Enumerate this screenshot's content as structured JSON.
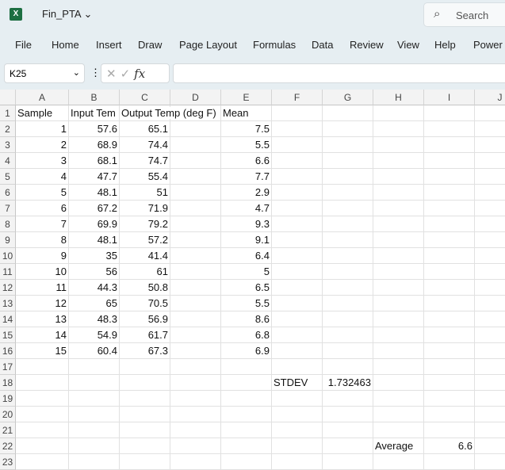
{
  "app": {
    "title": "Fin_PTA",
    "search_placeholder": "Search"
  },
  "menu": [
    "File",
    "Home",
    "Insert",
    "Draw",
    "Page Layout",
    "Formulas",
    "Data",
    "Review",
    "View",
    "Help",
    "Power"
  ],
  "formula_bar": {
    "name_box": "K25",
    "formula": ""
  },
  "columns": [
    "A",
    "B",
    "C",
    "D",
    "E",
    "F",
    "G",
    "H",
    "I",
    "J"
  ],
  "rows": [
    [
      "Sample",
      "Input Tem",
      "Output Temp (deg F)",
      "",
      "Mean",
      "",
      "",
      "",
      "",
      ""
    ],
    [
      "1",
      "57.6",
      "65.1",
      "",
      "7.5",
      "",
      "",
      "",
      "",
      ""
    ],
    [
      "2",
      "68.9",
      "74.4",
      "",
      "5.5",
      "",
      "",
      "",
      "",
      ""
    ],
    [
      "3",
      "68.1",
      "74.7",
      "",
      "6.6",
      "",
      "",
      "",
      "",
      ""
    ],
    [
      "4",
      "47.7",
      "55.4",
      "",
      "7.7",
      "",
      "",
      "",
      "",
      ""
    ],
    [
      "5",
      "48.1",
      "51",
      "",
      "2.9",
      "",
      "",
      "",
      "",
      ""
    ],
    [
      "6",
      "67.2",
      "71.9",
      "",
      "4.7",
      "",
      "",
      "",
      "",
      ""
    ],
    [
      "7",
      "69.9",
      "79.2",
      "",
      "9.3",
      "",
      "",
      "",
      "",
      ""
    ],
    [
      "8",
      "48.1",
      "57.2",
      "",
      "9.1",
      "",
      "",
      "",
      "",
      ""
    ],
    [
      "9",
      "35",
      "41.4",
      "",
      "6.4",
      "",
      "",
      "",
      "",
      ""
    ],
    [
      "10",
      "56",
      "61",
      "",
      "5",
      "",
      "",
      "",
      "",
      ""
    ],
    [
      "11",
      "44.3",
      "50.8",
      "",
      "6.5",
      "",
      "",
      "",
      "",
      ""
    ],
    [
      "12",
      "65",
      "70.5",
      "",
      "5.5",
      "",
      "",
      "",
      "",
      ""
    ],
    [
      "13",
      "48.3",
      "56.9",
      "",
      "8.6",
      "",
      "",
      "",
      "",
      ""
    ],
    [
      "14",
      "54.9",
      "61.7",
      "",
      "6.8",
      "",
      "",
      "",
      "",
      ""
    ],
    [
      "15",
      "60.4",
      "67.3",
      "",
      "6.9",
      "",
      "",
      "",
      "",
      ""
    ],
    [
      "",
      "",
      "",
      "",
      "",
      "",
      "",
      "",
      "",
      ""
    ],
    [
      "",
      "",
      "",
      "",
      "",
      "STDEV",
      "1.732463",
      "",
      "",
      ""
    ],
    [
      "",
      "",
      "",
      "",
      "",
      "",
      "",
      "",
      "",
      ""
    ],
    [
      "",
      "",
      "",
      "",
      "",
      "",
      "",
      "",
      "",
      ""
    ],
    [
      "",
      "",
      "",
      "",
      "",
      "",
      "",
      "",
      "",
      ""
    ],
    [
      "",
      "",
      "",
      "",
      "",
      "",
      "",
      "Average",
      "6.6",
      ""
    ],
    [
      "",
      "",
      "",
      "",
      "",
      "",
      "",
      "",
      "",
      ""
    ]
  ]
}
